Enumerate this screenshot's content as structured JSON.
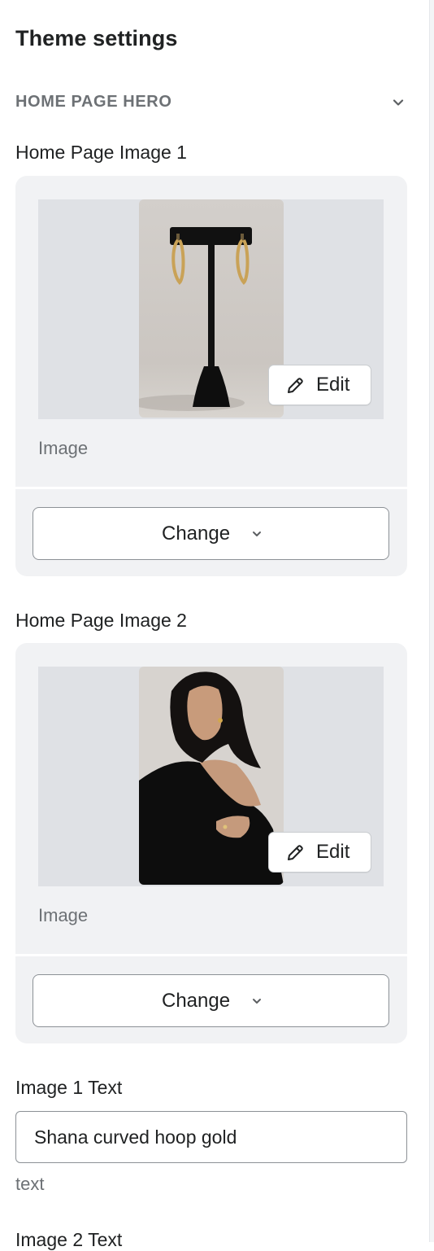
{
  "panel": {
    "title": "Theme settings",
    "section": {
      "title": "HOME PAGE HERO",
      "toggle_icon": "chevron-down-icon"
    }
  },
  "fields": [
    {
      "label": "Home Page Image 1",
      "caption": "Image",
      "edit_label": "Edit",
      "change_label": "Change",
      "image": "gold hoop earrings on black T-shaped stand"
    },
    {
      "label": "Home Page Image 2",
      "caption": "Image",
      "edit_label": "Edit",
      "change_label": "Change",
      "image": "woman in black off-shoulder top wearing gold earring"
    }
  ],
  "image1_text": {
    "label": "Image 1 Text",
    "value": "Shana curved hoop gold",
    "help": "text"
  },
  "image2_text": {
    "label": "Image 2 Text"
  },
  "colors": {
    "card_bg": "#f1f2f4",
    "image_frame_bg": "#dfe1e5",
    "muted_text": "#6d7175",
    "border": "#8c9196"
  }
}
